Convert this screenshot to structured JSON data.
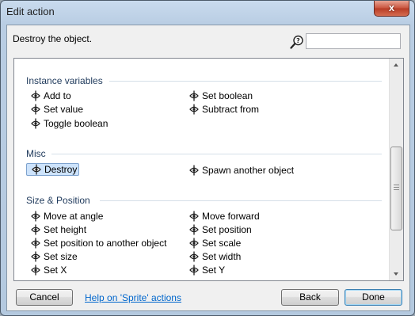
{
  "window": {
    "title": "Edit action",
    "close_label": "x"
  },
  "description": "Destroy the object.",
  "search": {
    "value": "",
    "placeholder": ""
  },
  "sections": [
    {
      "title": "Instance variables",
      "items": [
        "Add to",
        "Set boolean",
        "Set value",
        "Subtract from",
        "Toggle boolean"
      ]
    },
    {
      "title": "Misc",
      "items": [
        "Destroy",
        "Spawn another object"
      ],
      "selected": "Destroy"
    },
    {
      "title": "Size & Position",
      "items": [
        "Move at angle",
        "Move forward",
        "Set height",
        "Set position",
        "Set position to another object",
        "Set scale",
        "Set size",
        "Set width",
        "Set X",
        "Set Y"
      ]
    }
  ],
  "buttons": {
    "cancel": "Cancel",
    "help": "Help on 'Sprite' actions",
    "back": "Back",
    "done": "Done"
  },
  "scrollbar": {
    "position_fraction": 0.55
  },
  "colors": {
    "section_header": "#1e395b",
    "link": "#0066cc",
    "selection_bg": "#cde3fb",
    "selection_border": "#7da2ce"
  }
}
